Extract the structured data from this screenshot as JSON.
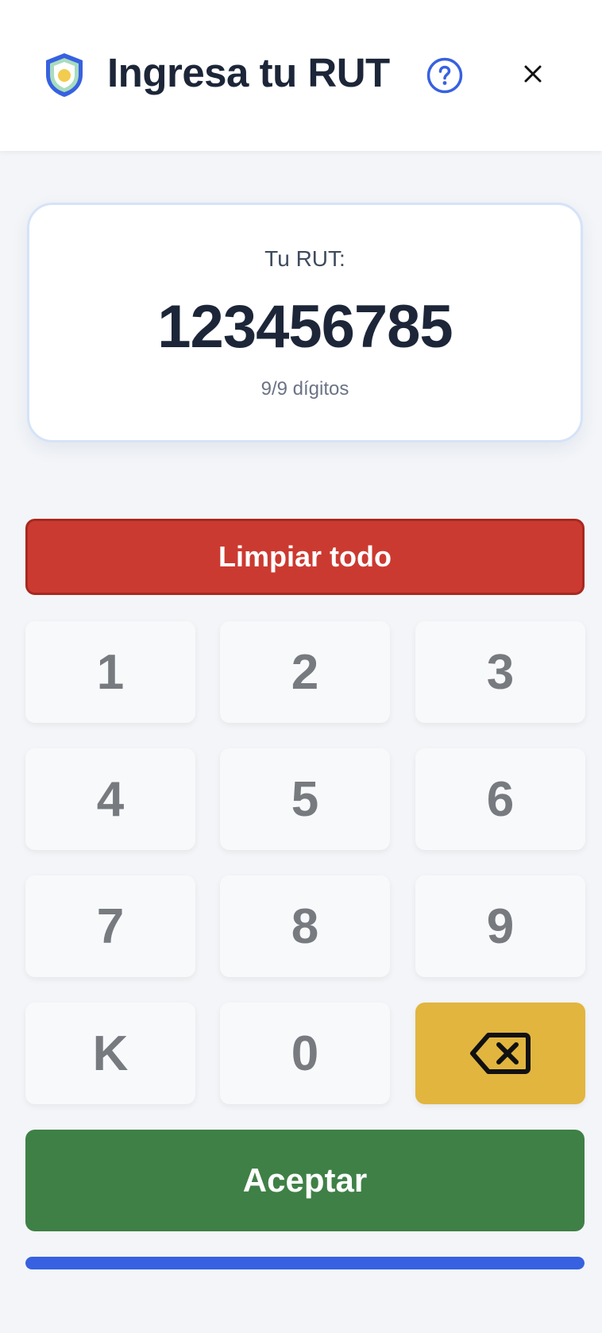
{
  "header": {
    "title": "Ingresa tu RUT",
    "icons": {
      "logo": "shield-icon",
      "help": "help-circle-icon",
      "close": "close-icon"
    }
  },
  "rut_display": {
    "label": "Tu RUT:",
    "value": "123456785",
    "digit_count": "9/9 dígitos"
  },
  "clear_button": {
    "label": "Limpiar todo"
  },
  "keypad": {
    "keys": [
      "1",
      "2",
      "3",
      "4",
      "5",
      "6",
      "7",
      "8",
      "9",
      "K",
      "0"
    ],
    "backspace_icon": "backspace-icon"
  },
  "accept_button": {
    "label": "Aceptar"
  },
  "progress": {
    "fraction": 1.0
  },
  "colors": {
    "accent": "#3761e0",
    "clear": "#cb3a31",
    "backspace": "#e2b53f",
    "accept": "#3f8046",
    "text_dark": "#1c2638"
  }
}
